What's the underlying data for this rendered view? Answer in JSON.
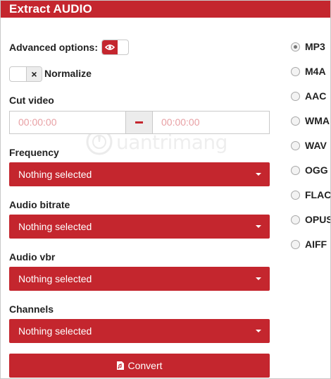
{
  "header": {
    "title": "Extract AUDIO"
  },
  "advanced_options": {
    "label": "Advanced options:"
  },
  "normalize": {
    "label": "Normalize"
  },
  "cut_video": {
    "label": "Cut video",
    "start_placeholder": "00:00:00",
    "end_placeholder": "00:00:00"
  },
  "frequency": {
    "label": "Frequency",
    "value": "Nothing selected"
  },
  "audio_bitrate": {
    "label": "Audio bitrate",
    "value": "Nothing selected"
  },
  "audio_vbr": {
    "label": "Audio vbr",
    "value": "Nothing selected"
  },
  "channels": {
    "label": "Channels",
    "value": "Nothing selected"
  },
  "convert": {
    "label": "Convert"
  },
  "formats": [
    {
      "label": "MP3",
      "checked": true
    },
    {
      "label": "M4A",
      "checked": false
    },
    {
      "label": "AAC",
      "checked": false
    },
    {
      "label": "WMA",
      "checked": false
    },
    {
      "label": "WAV",
      "checked": false
    },
    {
      "label": "OGG",
      "checked": false
    },
    {
      "label": "FLAC",
      "checked": false
    },
    {
      "label": "OPUS",
      "checked": false
    },
    {
      "label": "AIFF",
      "checked": false
    }
  ],
  "watermark": {
    "text": "uantrimang"
  },
  "colors": {
    "accent": "#c4262e",
    "placeholder": "#e8a0a4"
  }
}
